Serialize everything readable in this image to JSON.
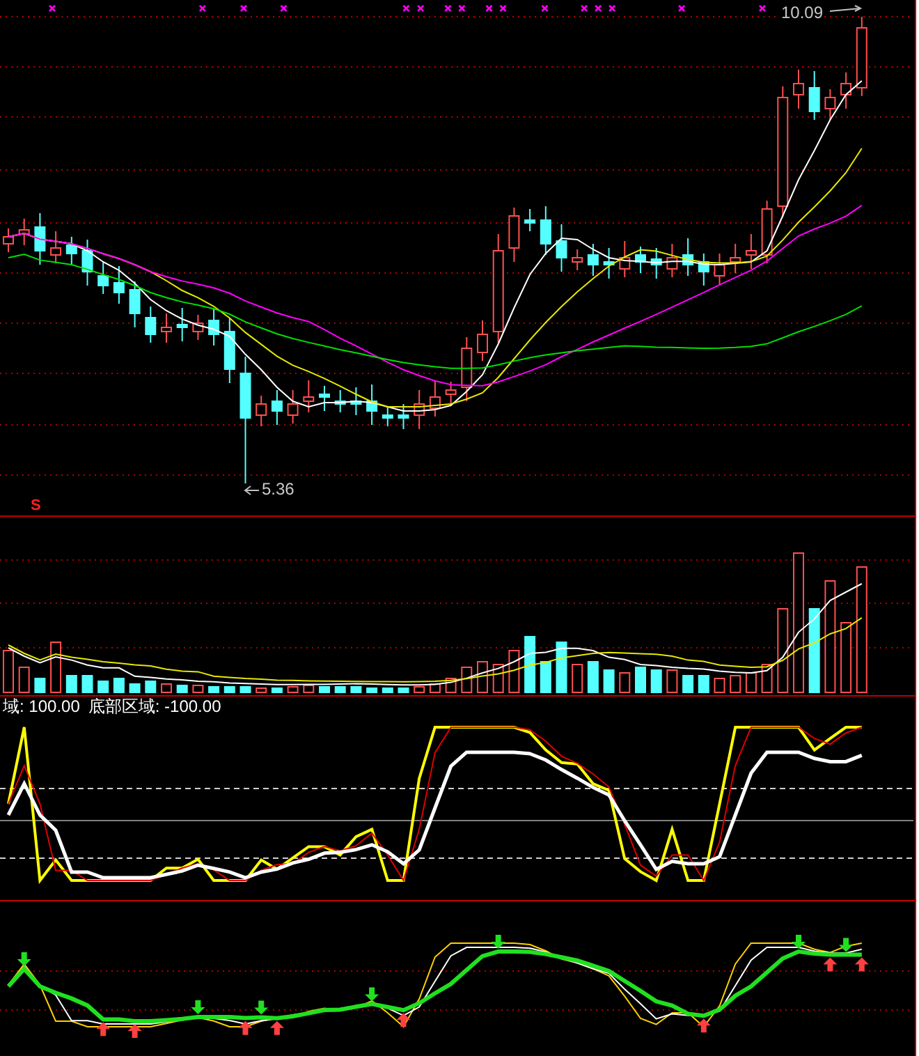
{
  "price_panel": {
    "high_label": "10.09",
    "low_label": "5.36",
    "signal_mark": "S"
  },
  "indicator_panel": {
    "legend_top": "域: 100.00",
    "legend_bottom": "底部区域: -100.00"
  }
}
